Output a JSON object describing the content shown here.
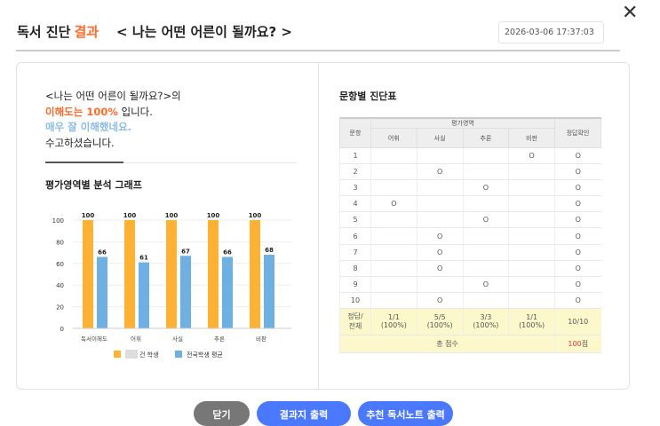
{
  "header": {
    "title": "독서 진단",
    "title_accent": "결과",
    "book": "< 나는 어떤 어른이 될까요? >",
    "datetime": "2026-03-06 17:37:03",
    "close": "✕"
  },
  "summary": {
    "line1": "<나는 어떤 어른이 될까요?>의",
    "understanding": "이해도는 100%",
    "line2_rest": " 입니다.",
    "praise": "매우 잘 이해했네요.",
    "thanks": "수고하셨습니다."
  },
  "chart_section_title": "평가영역별 분석 그래프",
  "chart_data": {
    "type": "bar",
    "categories": [
      "독서이해도",
      "어휘",
      "사실",
      "추론",
      "비판"
    ],
    "series": [
      {
        "name": "건 학생",
        "color": "#ffb133",
        "values": [
          100,
          100,
          100,
          100,
          100
        ]
      },
      {
        "name": "전국학생 평균",
        "color": "#6fb0e2",
        "values": [
          66,
          61,
          67,
          66,
          68
        ]
      }
    ],
    "yticks": [
      0,
      20,
      40,
      60,
      80,
      100
    ],
    "ylim": [
      0,
      100
    ]
  },
  "table_section_title": "문항별 진단표",
  "table": {
    "h_no": "문항",
    "h_area": "평가영역",
    "h_check": "정답확인",
    "areas": [
      "어휘",
      "사실",
      "추론",
      "비판"
    ],
    "rows": [
      [
        "1",
        "",
        "",
        "",
        "O",
        "O"
      ],
      [
        "2",
        "",
        "O",
        "",
        "",
        "O"
      ],
      [
        "3",
        "",
        "",
        "O",
        "",
        "O"
      ],
      [
        "4",
        "O",
        "",
        "",
        "",
        "O"
      ],
      [
        "5",
        "",
        "",
        "O",
        "",
        "O"
      ],
      [
        "6",
        "",
        "O",
        "",
        "",
        "O"
      ],
      [
        "7",
        "",
        "O",
        "",
        "",
        "O"
      ],
      [
        "8",
        "",
        "O",
        "",
        "",
        "O"
      ],
      [
        "9",
        "",
        "",
        "O",
        "",
        "O"
      ],
      [
        "10",
        "",
        "O",
        "",
        "",
        "O"
      ]
    ],
    "total_label": "정답/\n전체",
    "totals": [
      "1/1\n(100%)",
      "5/5\n(100%)",
      "3/3\n(100%)",
      "1/1\n(100%)",
      "10/10"
    ],
    "score_label": "총 점수",
    "score_value": "100",
    "score_unit": "점"
  },
  "buttons": {
    "close": "닫기",
    "print_result": "결과지 출력",
    "print_note": "추천 독서노트 출력"
  },
  "colors": {
    "accent": "#ff6a2b",
    "blue_btn": "#4a78ff",
    "gray_btn": "#777777"
  }
}
